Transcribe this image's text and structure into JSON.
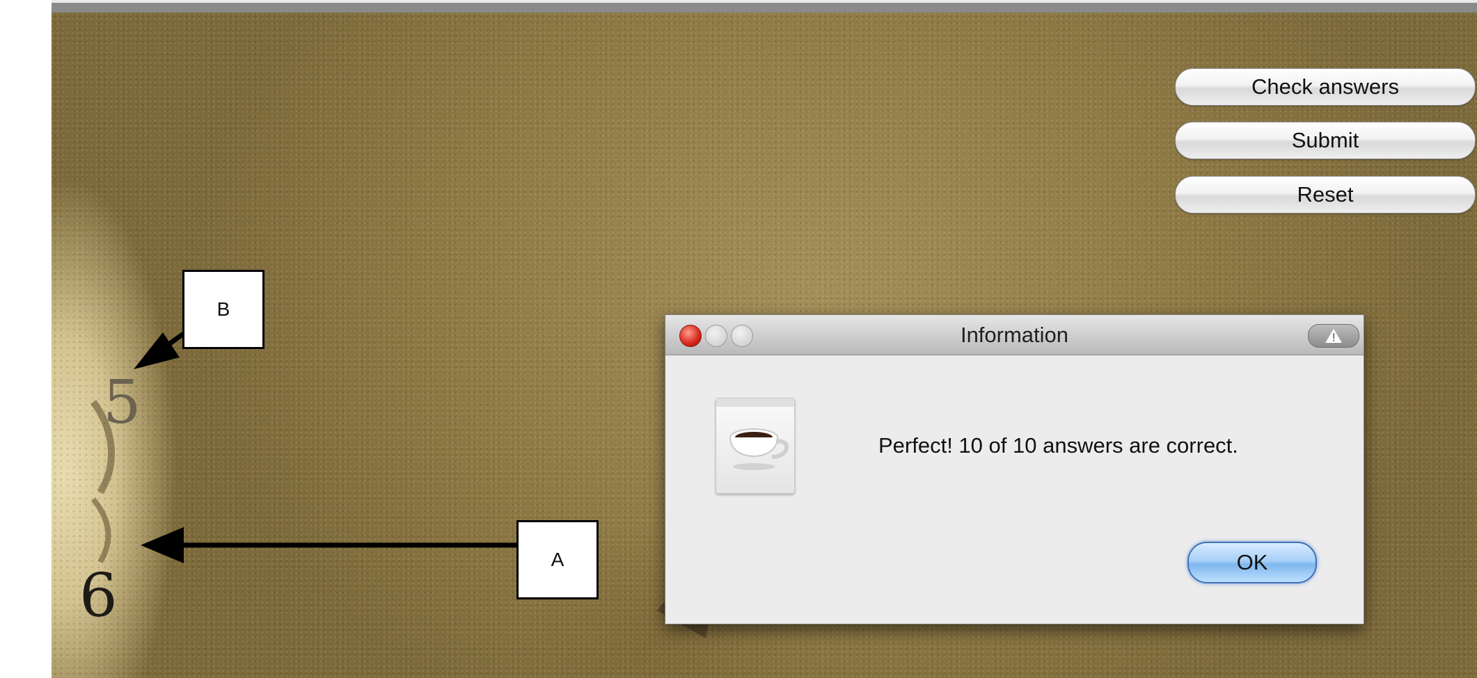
{
  "buttons": {
    "check_answers": "Check answers",
    "submit": "Submit",
    "reset": "Reset"
  },
  "image_labels": {
    "label_b": "B",
    "label_a": "A",
    "number_5": "5",
    "number_6": "6"
  },
  "dialog": {
    "title": "Information",
    "message": "Perfect!  10 of 10 answers are correct.",
    "ok_label": "OK",
    "icon": "java-coffee-cup-icon"
  },
  "colors": {
    "close_button": "#d8261a",
    "ok_button_accent": "#7fb7ee",
    "background_texture": "#8f7a45"
  }
}
